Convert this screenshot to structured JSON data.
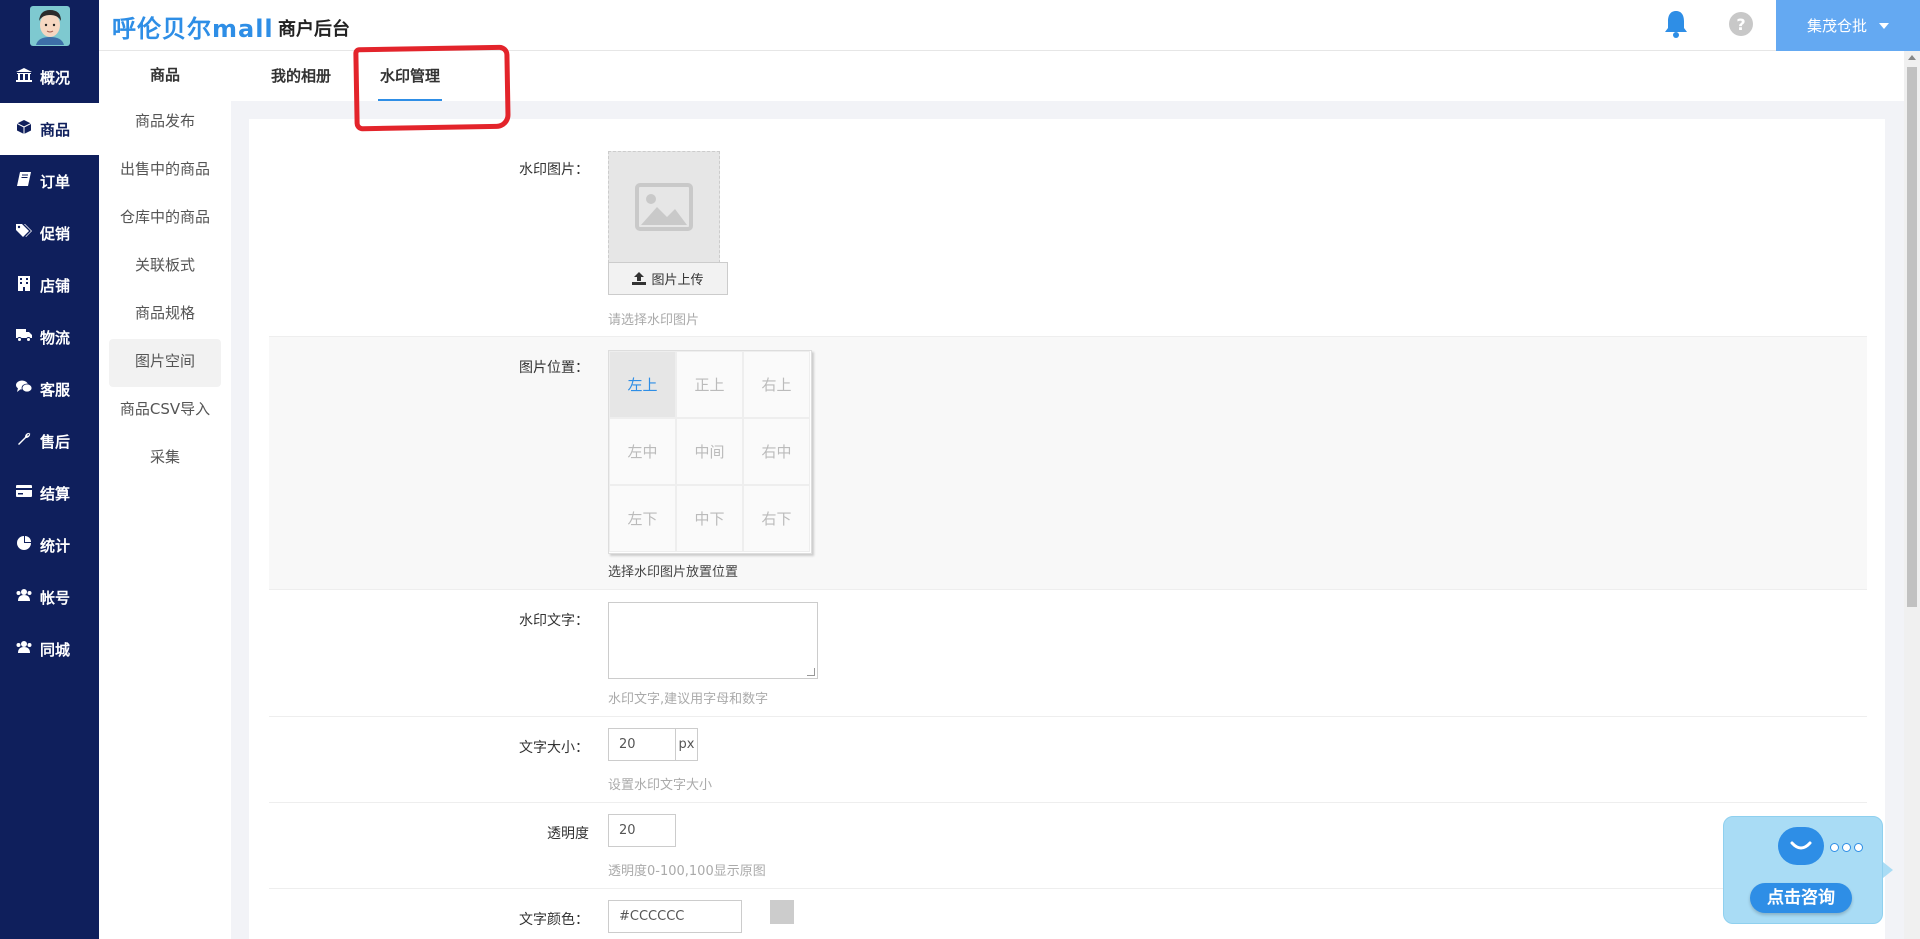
{
  "header": {
    "brand": "呼伦贝尔mall",
    "subtitle": "商户后台",
    "user": "集茂仓批"
  },
  "sidenav": {
    "items": [
      {
        "label": "概况",
        "icon": "bank-icon"
      },
      {
        "label": "商品",
        "icon": "cube-icon"
      },
      {
        "label": "订单",
        "icon": "book-icon"
      },
      {
        "label": "促销",
        "icon": "tags-icon"
      },
      {
        "label": "店铺",
        "icon": "building-icon"
      },
      {
        "label": "物流",
        "icon": "truck-icon"
      },
      {
        "label": "客服",
        "icon": "comments-icon"
      },
      {
        "label": "售后",
        "icon": "wrench-icon"
      },
      {
        "label": "结算",
        "icon": "credit-card-icon"
      },
      {
        "label": "统计",
        "icon": "pie-chart-icon"
      },
      {
        "label": "帐号",
        "icon": "users-icon"
      },
      {
        "label": "同城",
        "icon": "users-icon"
      }
    ],
    "active": "商品"
  },
  "subnav": {
    "title": "商品",
    "items": [
      "商品发布",
      "出售中的商品",
      "仓库中的商品",
      "关联板式",
      "商品规格",
      "图片空间",
      "商品CSV导入",
      "采集"
    ],
    "active": "图片空间"
  },
  "tabs": {
    "album": "我的相册",
    "watermark": "水印管理"
  },
  "form": {
    "watermark_image_label": "水印图片：",
    "upload_button": "图片上传",
    "watermark_image_hint": "请选择水印图片",
    "position_label": "图片位置：",
    "positions": [
      "左上",
      "正上",
      "右上",
      "左中",
      "中间",
      "右中",
      "左下",
      "中下",
      "右下"
    ],
    "selected_position": "左上",
    "position_hint": "选择水印图片放置位置",
    "text_label": "水印文字：",
    "text_value": "",
    "text_hint": "水印文字,建议用字母和数字",
    "size_label": "文字大小：",
    "size_value": "20",
    "size_unit": "px",
    "size_hint": "设置水印文字大小",
    "opacity_label": "透明度",
    "opacity_value": "20",
    "opacity_hint": "透明度0-100,100显示原图",
    "color_label": "文字颜色：",
    "color_value": "#CCCCCC"
  },
  "consult": {
    "button": "点击咨询"
  },
  "colors": {
    "nav_bg": "#0f1f5c",
    "accent": "#2e8ee6",
    "user_button": "#64a9f2",
    "annotation_red": "#e3242b"
  }
}
